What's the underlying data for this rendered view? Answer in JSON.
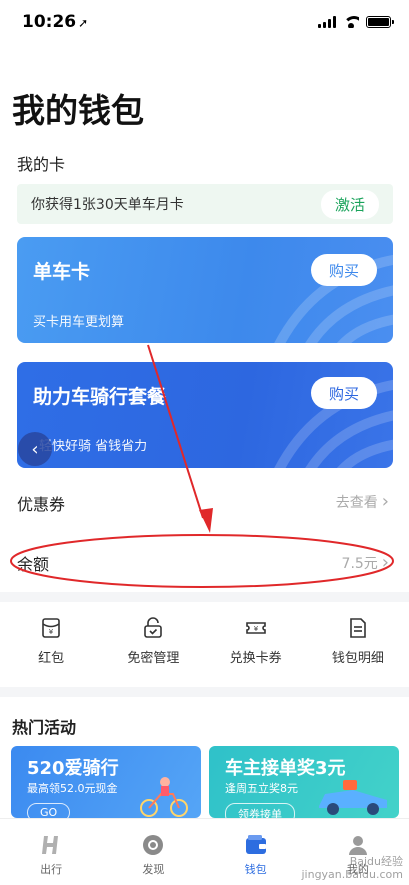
{
  "status": {
    "time": "10:26"
  },
  "page": {
    "title": "我的钱包"
  },
  "my_cards": {
    "label": "我的卡",
    "promo_text": "你获得1张30天单车月卡",
    "activate_label": "激活",
    "cards": [
      {
        "title": "单车卡",
        "subtitle": "买卡用车更划算",
        "buy_label": "购买"
      },
      {
        "title": "助力车骑行套餐",
        "subtitle": "轻快好骑 省钱省力",
        "buy_label": "购买"
      }
    ]
  },
  "coupons": {
    "label": "优惠券",
    "action": "去查看"
  },
  "balance": {
    "label": "余额",
    "value": "7.5元"
  },
  "quick_actions": [
    {
      "label": "红包",
      "icon": "red-packet-icon"
    },
    {
      "label": "免密管理",
      "icon": "lock-icon"
    },
    {
      "label": "兑换卡券",
      "icon": "ticket-icon"
    },
    {
      "label": "钱包明细",
      "icon": "document-icon"
    }
  ],
  "hot": {
    "title": "热门活动",
    "activities": [
      {
        "title": "520爱骑行",
        "subtitle": "最高领52.0元现金",
        "pill": "GO"
      },
      {
        "title": "车主接单奖3元",
        "subtitle": "逢周五立奖8元",
        "pill": "领券接单"
      }
    ]
  },
  "tabs": [
    {
      "label": "出行",
      "icon": "hello-logo-icon"
    },
    {
      "label": "发现",
      "icon": "discover-icon"
    },
    {
      "label": "钱包",
      "icon": "wallet-icon",
      "active": true
    },
    {
      "label": "我的",
      "icon": "profile-icon"
    }
  ],
  "colors": {
    "accent": "#2d6de0",
    "green": "#1aa35b",
    "annotation": "#e0282a"
  },
  "watermark": {
    "line1": "Baidu经验",
    "line2": "jingyan.baidu.com"
  }
}
